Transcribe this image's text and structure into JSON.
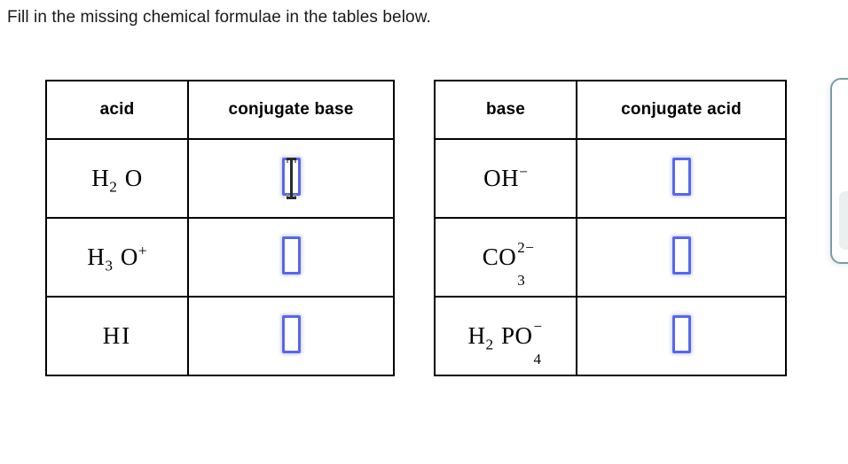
{
  "prompt": {
    "text": "Fill in the missing chemical formulae in the tables below."
  },
  "tables": [
    {
      "name": "acid-conjugate-base",
      "headers": [
        "acid",
        "conjugate base"
      ],
      "rows": [
        {
          "species": "H2O",
          "answer": ""
        },
        {
          "species": "H3O+",
          "answer": ""
        },
        {
          "species": "HI",
          "answer": ""
        }
      ]
    },
    {
      "name": "base-conjugate-acid",
      "headers": [
        "base",
        "conjugate acid"
      ],
      "rows": [
        {
          "species": "OH-",
          "answer": ""
        },
        {
          "species": "CO3^2-",
          "answer": ""
        },
        {
          "species": "H2PO4-",
          "answer": ""
        }
      ]
    }
  ],
  "formulae": {
    "h2o": {
      "a": "H",
      "sub1": "2",
      "b": "O"
    },
    "h3o": {
      "a": "H",
      "sub1": "3",
      "b": "O",
      "sup1": "+"
    },
    "hi": {
      "text": "HI"
    },
    "oh": {
      "a": "OH",
      "sup1": "−"
    },
    "co3": {
      "a": "CO",
      "sup1": "2−",
      "sub1": "3"
    },
    "h2po4": {
      "a": "H",
      "sub1": "2",
      "b": "PO",
      "sup2": "−",
      "sub2": "4"
    }
  },
  "answer_boxes": {
    "placeholder": "",
    "count": 6,
    "border_color": "#5766ee",
    "glow_color": "#7e8cf5"
  },
  "cursor": {
    "type": "text-ibeam",
    "over": "answer-box-acid-row-1"
  },
  "side_panel": {
    "border_color": "#7d9aa3",
    "chip_color": "#eceff0"
  }
}
